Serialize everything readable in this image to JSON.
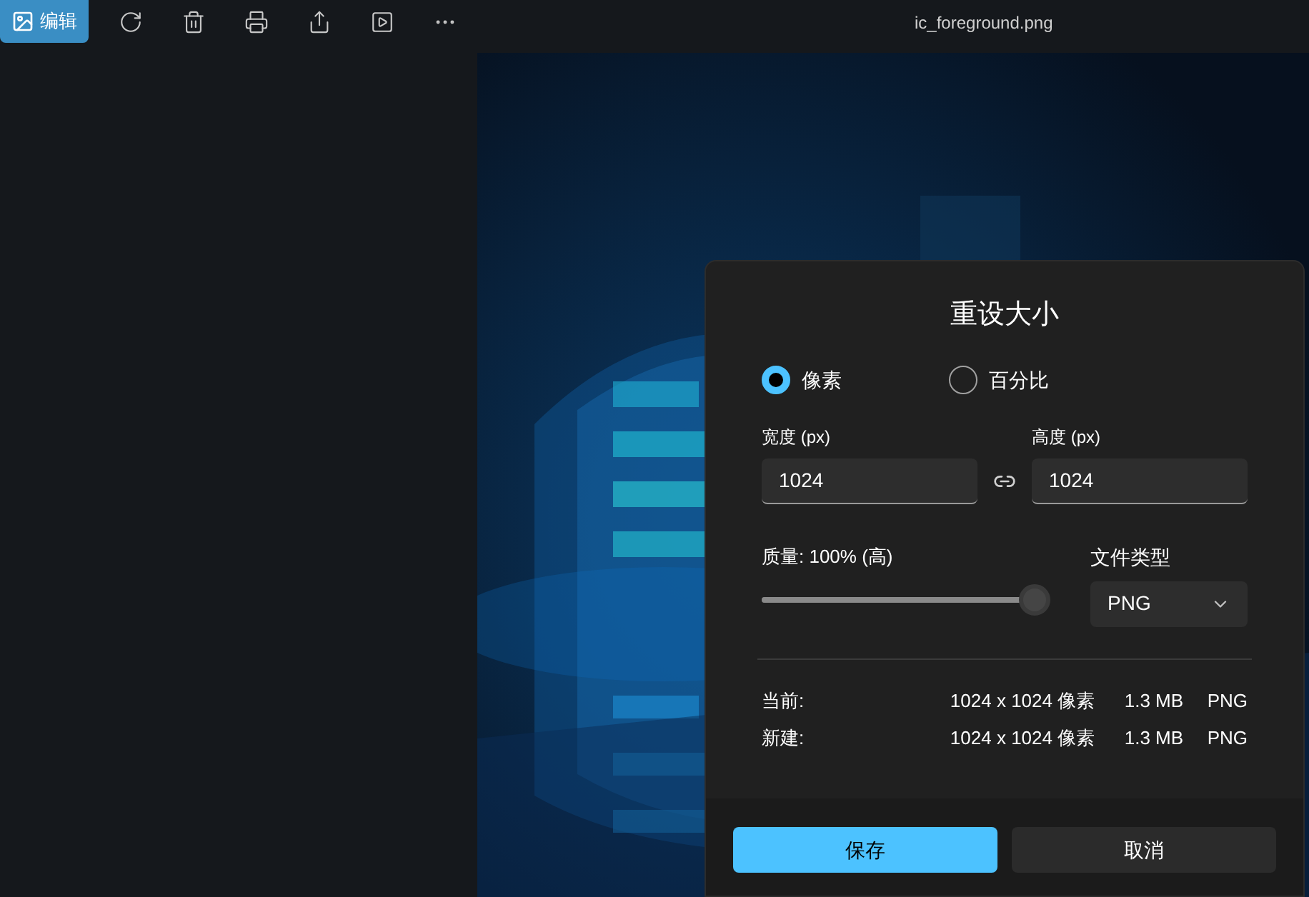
{
  "toolbar": {
    "edit_button": {
      "label": "编辑",
      "selected": true
    },
    "file_name": "ic_foreground.png"
  },
  "dialog": {
    "title": "重设大小",
    "units": [
      {
        "label": "像素",
        "selected": true
      },
      {
        "label": "百分比",
        "selected": false
      }
    ],
    "width": {
      "label": "宽度 (px)",
      "value": "1024"
    },
    "height": {
      "label": "高度 (px)",
      "value": "1024"
    },
    "quality": {
      "label": "质量: 100% (高)",
      "level": 1
    },
    "file_type": {
      "label": "文件类型",
      "value": "PNG"
    },
    "info_rows": [
      {
        "label": "当前:",
        "dimensions": "1024 x 1024 像素",
        "size": "1.3 MB",
        "format": "PNG"
      },
      {
        "label": "新建:",
        "dimensions": "1024 x 1024 像素",
        "size": "1.3 MB",
        "format": "PNG"
      }
    ],
    "buttons": [
      {
        "label": "保存",
        "kind": "primary"
      },
      {
        "label": "取消",
        "kind": "secondary"
      }
    ]
  }
}
